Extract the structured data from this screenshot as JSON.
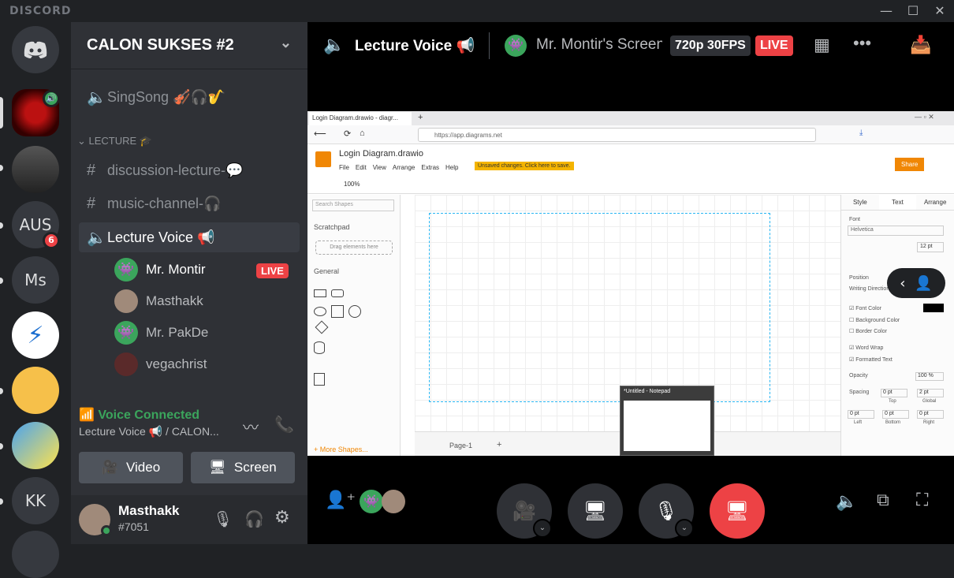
{
  "app": {
    "brand": "DISCORD"
  },
  "servers": [
    {
      "label": ""
    },
    {
      "label": ""
    },
    {
      "label": ""
    },
    {
      "label": "AUS",
      "badge": "6"
    },
    {
      "label": "Ms"
    },
    {
      "label": ""
    },
    {
      "label": ""
    },
    {
      "label": ""
    },
    {
      "label": "KK"
    }
  ],
  "guild": {
    "name": "CALON SUKSES #2"
  },
  "channels": {
    "singsong": "SingSong 🎻🎧🎷",
    "category": "LECTURE 🎓",
    "discussion": "discussion-lecture-💬",
    "music": "music-channel-🎧",
    "lecture_voice": "Lecture Voice 📢"
  },
  "voice_users": [
    {
      "name": "Mr. Montir",
      "live": "LIVE"
    },
    {
      "name": "Masthakk"
    },
    {
      "name": "Mr. PakDe"
    },
    {
      "name": "vegachrist"
    }
  ],
  "voice_status": {
    "title": "Voice Connected",
    "subtitle": "Lecture Voice 📢 / CALON..."
  },
  "buttons": {
    "video": "Video",
    "screen": "Screen"
  },
  "user": {
    "name": "Masthakk",
    "tag": "#7051"
  },
  "header": {
    "channel": "Lecture Voice 📢",
    "stream": "Mr. Montir's Screen",
    "quality": "720p 30FPS",
    "live": "LIVE"
  },
  "browser": {
    "tab": "Login Diagram.drawio - diagr...",
    "url": "https://app.diagrams.net",
    "doc_title": "Login Diagram.drawio",
    "menus": [
      "File",
      "Edit",
      "View",
      "Arrange",
      "Extras",
      "Help"
    ],
    "unsaved": "Unsaved changes. Click here to save.",
    "share": "Share",
    "zoom": "100%",
    "search_placeholder": "Search Shapes",
    "scratchpad": "Scratchpad",
    "drag_here": "Drag elements here",
    "general": "General",
    "more_shapes": "+ More Shapes...",
    "page": "Page-1",
    "panel_tabs": [
      "Style",
      "Text",
      "Arrange"
    ],
    "font_label": "Font",
    "font_value": "Helvetica",
    "font_size": "12 pt",
    "position": "Position",
    "writing_direction": "Writing Direction",
    "font_color": "Font Color",
    "background_color": "Background Color",
    "border_color": "Border Color",
    "word_wrap": "Word Wrap",
    "formatted_text": "Formatted Text",
    "opacity": "Opacity",
    "opacity_value": "100 %",
    "spacing": "Spacing",
    "spacing_top": "0 pt",
    "spacing_global": "2 pt",
    "top": "Top",
    "global": "Global",
    "spacing_left": "0 pt",
    "spacing_bottom": "0 pt",
    "spacing_right": "0 pt",
    "left": "Left",
    "bottom": "Bottom",
    "right": "Right",
    "notepad": "*Untitled - Notepad"
  }
}
